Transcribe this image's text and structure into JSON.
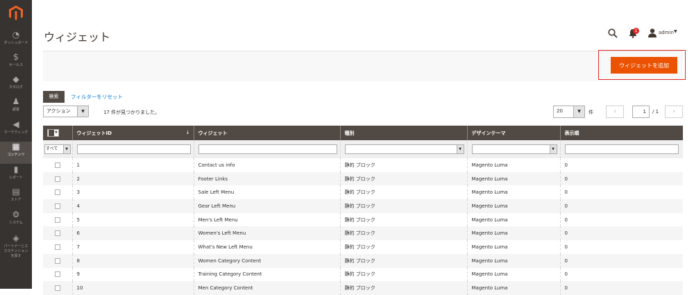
{
  "sidebar": {
    "items": [
      {
        "label": "ダッシュボード",
        "icon": "dashboard-icon",
        "glyph": "◔"
      },
      {
        "label": "セールス",
        "icon": "dollar-icon",
        "glyph": "$"
      },
      {
        "label": "カタログ",
        "icon": "cube-icon",
        "glyph": "◆"
      },
      {
        "label": "顧客",
        "icon": "customer-icon",
        "glyph": "♟"
      },
      {
        "label": "マーケティング",
        "icon": "megaphone-icon",
        "glyph": "◀"
      },
      {
        "label": "コンテンツ",
        "icon": "content-icon",
        "glyph": "▦"
      },
      {
        "label": "レポート",
        "icon": "reports-icon",
        "glyph": "▮"
      },
      {
        "label": "ストア",
        "icon": "store-icon",
        "glyph": "▤"
      },
      {
        "label": "システム",
        "icon": "gear-icon",
        "glyph": "⚙"
      },
      {
        "label": "パートナーとエ\nクステンション\nを探す",
        "icon": "extensions-icon",
        "glyph": "◈"
      }
    ],
    "active_index": 5
  },
  "header": {
    "title": "ウィジェット",
    "notification_count": "1",
    "user": "admin"
  },
  "actions": {
    "add_label": "ウィジェットを追加"
  },
  "toolbar": {
    "search_label": "検索",
    "reset_label": "フィルターをリセット",
    "action_select": "アクション",
    "found_text": "17 件が見つかりました。",
    "per_page": "20",
    "per_page_unit": "件",
    "current_page": "1",
    "total_pages": "/ 1"
  },
  "grid": {
    "columns": [
      "ウィジェットID",
      "ウィジェット",
      "種別",
      "デザインテーマ",
      "表示順"
    ],
    "filter_all": "すべて",
    "rows": [
      {
        "id": "1",
        "name": "Contact us info",
        "type": "静的 ブロック",
        "theme": "Magento Luma",
        "order": "0"
      },
      {
        "id": "2",
        "name": "Footer Links",
        "type": "静的 ブロック",
        "theme": "Magento Luma",
        "order": "0"
      },
      {
        "id": "3",
        "name": "Sale Left Menu",
        "type": "静的 ブロック",
        "theme": "Magento Luma",
        "order": "0"
      },
      {
        "id": "4",
        "name": "Gear Left Menu",
        "type": "静的 ブロック",
        "theme": "Magento Luma",
        "order": "0"
      },
      {
        "id": "5",
        "name": "Men's Left Menu",
        "type": "静的 ブロック",
        "theme": "Magento Luma",
        "order": "0"
      },
      {
        "id": "6",
        "name": "Women's Left Menu",
        "type": "静的 ブロック",
        "theme": "Magento Luma",
        "order": "0"
      },
      {
        "id": "7",
        "name": "What's New Left Menu",
        "type": "静的 ブロック",
        "theme": "Magento Luma",
        "order": "0"
      },
      {
        "id": "8",
        "name": "Women Category Content",
        "type": "静的 ブロック",
        "theme": "Magento Luma",
        "order": "0"
      },
      {
        "id": "9",
        "name": "Training Category Content",
        "type": "静的 ブロック",
        "theme": "Magento Luma",
        "order": "0"
      },
      {
        "id": "10",
        "name": "Men Category Content",
        "type": "静的 ブロック",
        "theme": "Magento Luma",
        "order": "0"
      }
    ]
  },
  "colors": {
    "sidebar_bg": "#373330",
    "accent": "#eb5202",
    "header_bg": "#514943",
    "link": "#007bdb",
    "highlight_frame": "#e02b27"
  }
}
